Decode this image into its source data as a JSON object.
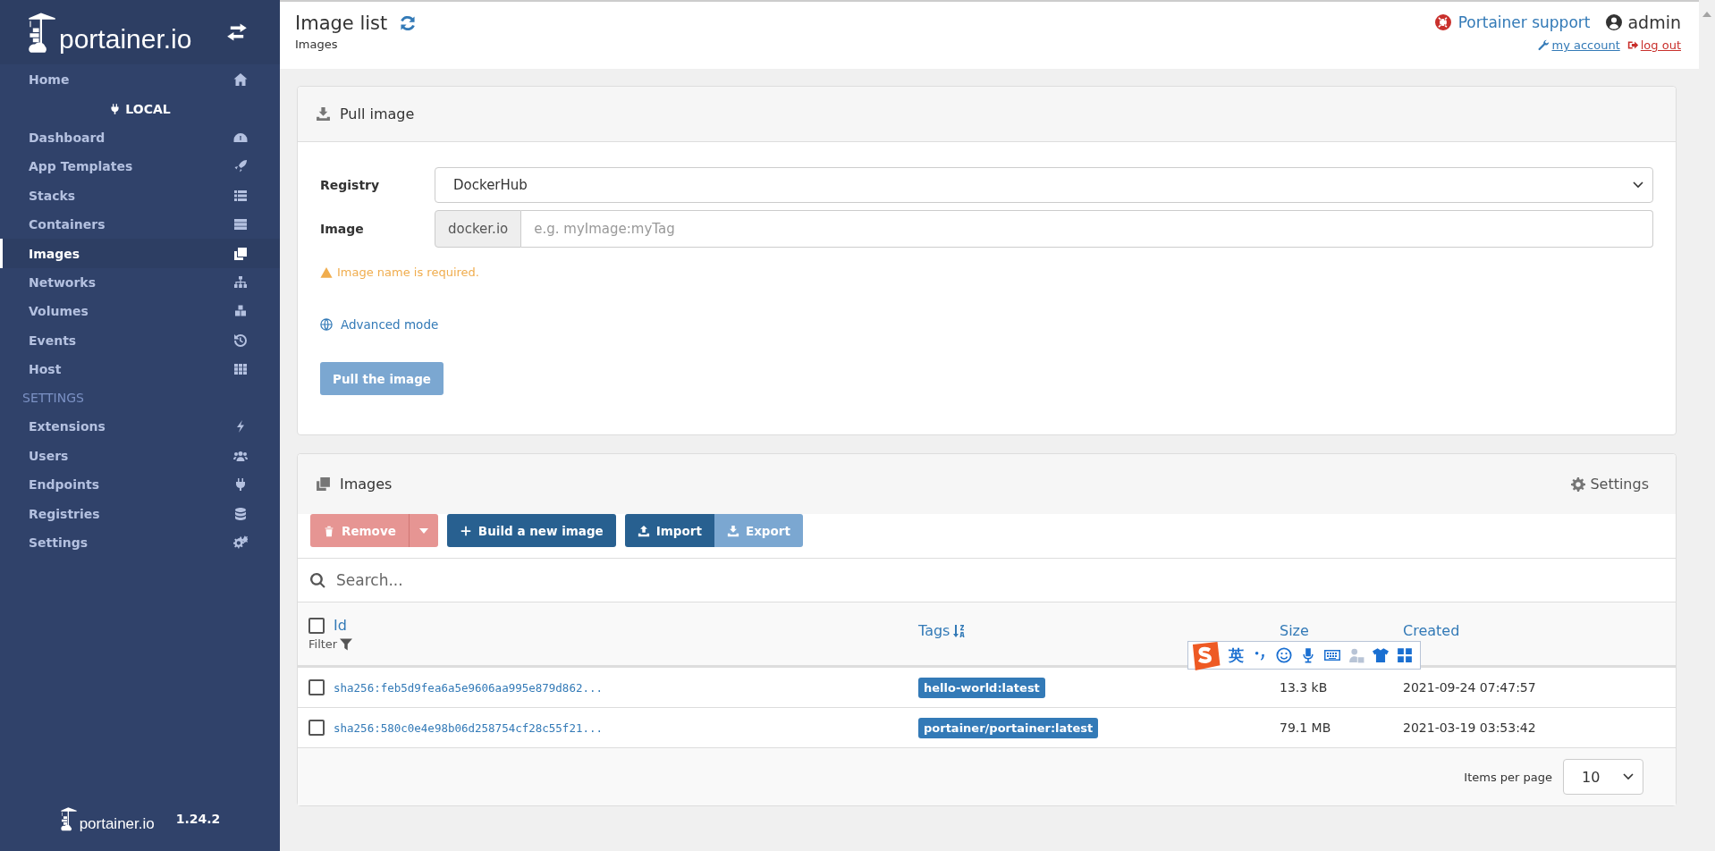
{
  "sidebar": {
    "brand": "portainer.io",
    "home": {
      "label": "Home",
      "selected": false
    },
    "endpoint": "LOCAL",
    "items": [
      {
        "label": "Dashboard",
        "selected": false
      },
      {
        "label": "App Templates",
        "selected": false
      },
      {
        "label": "Stacks",
        "selected": false
      },
      {
        "label": "Containers",
        "selected": false
      },
      {
        "label": "Images",
        "selected": true
      },
      {
        "label": "Networks",
        "selected": false
      },
      {
        "label": "Volumes",
        "selected": false
      },
      {
        "label": "Events",
        "selected": false
      },
      {
        "label": "Host",
        "selected": false
      }
    ],
    "settings_heading": "SETTINGS",
    "settings_items": [
      {
        "label": "Extensions",
        "selected": false
      },
      {
        "label": "Users",
        "selected": false
      },
      {
        "label": "Endpoints",
        "selected": false
      },
      {
        "label": "Registries",
        "selected": false
      },
      {
        "label": "Settings",
        "selected": false
      }
    ],
    "footer": {
      "brand": "portainer.io",
      "version": "1.24.2"
    }
  },
  "header": {
    "title": "Image list",
    "breadcrumb": "Images",
    "support": "Portainer support",
    "user": "admin",
    "my_account": "my account",
    "log_out": "log out"
  },
  "pull_image": {
    "title": "Pull image",
    "registry_label": "Registry",
    "registry_value": "DockerHub",
    "image_label": "Image",
    "image_prefix": "docker.io",
    "image_placeholder": "e.g. myImage:myTag",
    "warning": "Image name is required.",
    "advanced": "Advanced mode",
    "button": {
      "label": "Pull the image",
      "disabled": true
    }
  },
  "images": {
    "title": "Images",
    "settings": "Settings",
    "buttons": [
      {
        "label": "Remove",
        "kind": "danger",
        "disabled": true
      },
      {
        "label": "Build a new image",
        "kind": "build",
        "disabled": false
      },
      {
        "label": "Import",
        "kind": "import",
        "disabled": false
      },
      {
        "label": "Export",
        "kind": "export",
        "disabled": true
      }
    ],
    "search_placeholder": "Search...",
    "select_all": {
      "checked": false
    },
    "columns": {
      "id": "Id",
      "filter": "Filter",
      "tags": "Tags",
      "size": "Size",
      "created": "Created"
    },
    "rows": [
      {
        "checked": false,
        "id": "sha256:feb5d9fea6a5e9606aa995e879d862...",
        "tag": "hello-world:latest",
        "size": "13.3 kB",
        "created": "2021-09-24 07:47:57"
      },
      {
        "checked": false,
        "id": "sha256:580c0e4e98b06d258754cf28c55f21...",
        "tag": "portainer/portainer:latest",
        "size": "79.1 MB",
        "created": "2021-03-19 03:53:42"
      }
    ],
    "pagination": {
      "label": "Items per page",
      "value": "10"
    }
  },
  "ime_toolbar": {
    "mode": "英"
  }
}
